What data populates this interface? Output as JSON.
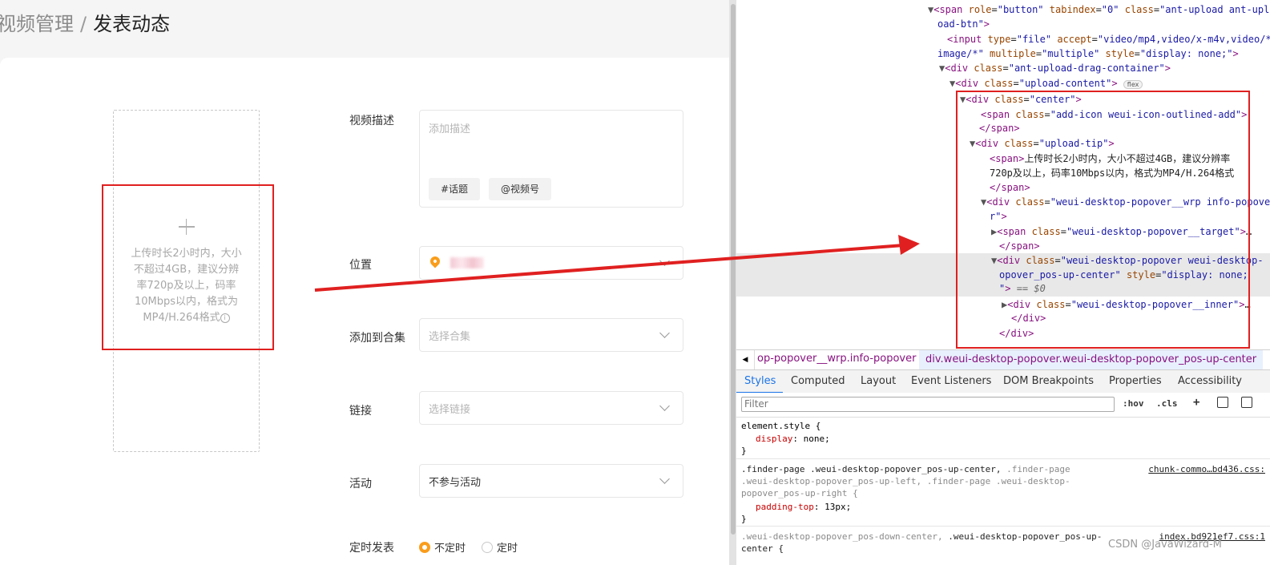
{
  "breadcrumb": {
    "parent": "视频管理",
    "separator": "/",
    "current": "发表动态"
  },
  "upload": {
    "tip": "上传时长2小时内，大小不超过4GB，建议分辨率720p及以上，码率10Mbps以内，格式为MP4/H.264格式",
    "info_glyph": "i"
  },
  "form": {
    "description": {
      "label": "视频描述",
      "placeholder": "添加描述",
      "topic_tag": "#话题",
      "mention_tag": "@视频号"
    },
    "location": {
      "label": "位置"
    },
    "collection": {
      "label": "添加到合集",
      "placeholder": "选择合集"
    },
    "link": {
      "label": "链接",
      "placeholder": "选择链接"
    },
    "activity": {
      "label": "活动",
      "value": "不参与活动"
    },
    "schedule": {
      "label": "定时发表",
      "option_none": "不定时",
      "option_timed": "定时"
    }
  },
  "devtools": {
    "badge": "flex",
    "breadcrumb_left": "op-popover__wrp.info-popover",
    "breadcrumb_right": "div.weui-desktop-popover.weui-desktop-popover_pos-up-center",
    "tabs": [
      "Styles",
      "Computed",
      "Layout",
      "Event Listeners",
      "DOM Breakpoints",
      "Properties",
      "Accessibility"
    ],
    "filter_placeholder": "Filter",
    "tools": {
      "hov": ":hov",
      "cls": ".cls",
      "plus": "+"
    },
    "rules": [
      {
        "selector": "element.style {",
        "prop": "display",
        "value": "none;"
      },
      {
        "selector": ".finder-page .weui-desktop-popover_pos-up-center,",
        "dim": ".finder-page",
        "dim2": ".weui-desktop-popover_pos-up-left, .finder-page .weui-desktop-",
        "dim3": "popover_pos-up-right {",
        "prop": "padding-top",
        "value": "13px;",
        "source": "chunk-commo…bd436.css:"
      },
      {
        "selector_dim": ".weui-desktop-popover_pos-down-center,",
        "selector": ".weui-desktop-popover_pos-up-",
        "selector2": "center {",
        "source": "index.bd921ef7.css:1"
      }
    ]
  },
  "watermark": "CSDN @JavaWizard-M",
  "colors": {
    "accent": "#fa9d1b",
    "annotation_red": "#e02020",
    "devtools_blue": "#1a73e8"
  }
}
